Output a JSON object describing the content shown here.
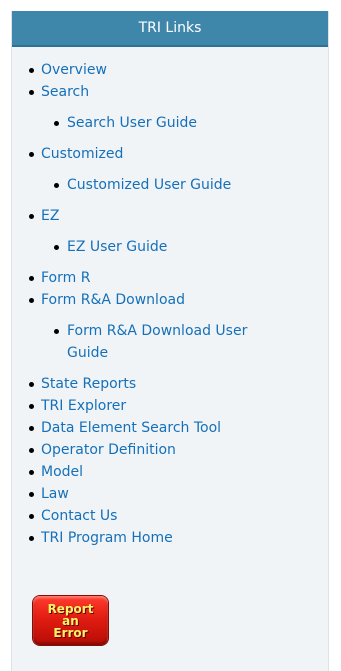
{
  "panel": {
    "title": "TRI Links"
  },
  "links": [
    {
      "label": "Overview"
    },
    {
      "label": "Search"
    },
    {
      "label": "Search User Guide"
    },
    {
      "label": "Customized"
    },
    {
      "label": "Customized User Guide"
    },
    {
      "label": "EZ"
    },
    {
      "label": "EZ User Guide"
    },
    {
      "label": "Form R"
    },
    {
      "label": "Form R&A Download"
    },
    {
      "label": "Form R&A Download User Guide"
    },
    {
      "label": "State Reports"
    },
    {
      "label": "TRI Explorer"
    },
    {
      "label": "Data Element Search Tool"
    },
    {
      "label": "Operator Definition"
    },
    {
      "label": "Model"
    },
    {
      "label": "Law"
    },
    {
      "label": "Contact Us"
    },
    {
      "label": "TRI Program Home"
    }
  ],
  "report_button": {
    "label": "Report\nan\nError"
  },
  "colors": {
    "header": "#3f87aa",
    "link": "#1570b9",
    "panel_bg": "#f1f4f7",
    "button": "#e21d12",
    "button_text": "#fff36a"
  }
}
